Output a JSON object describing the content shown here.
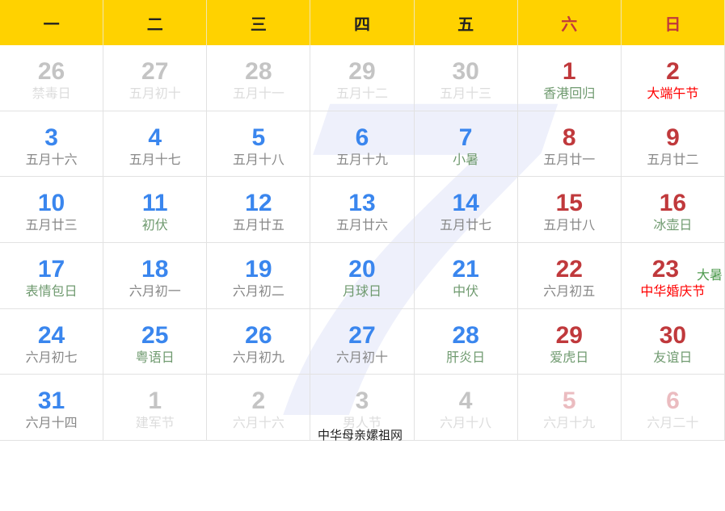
{
  "watermark": "7",
  "weekdays": [
    {
      "label": "一",
      "weekend": false
    },
    {
      "label": "二",
      "weekend": false
    },
    {
      "label": "三",
      "weekend": false
    },
    {
      "label": "四",
      "weekend": false
    },
    {
      "label": "五",
      "weekend": false
    },
    {
      "label": "六",
      "weekend": true
    },
    {
      "label": "日",
      "weekend": true
    }
  ],
  "days": [
    {
      "num": "26",
      "sub": "禁毒日",
      "month": "other"
    },
    {
      "num": "27",
      "sub": "五月初十",
      "month": "other"
    },
    {
      "num": "28",
      "sub": "五月十一",
      "month": "other"
    },
    {
      "num": "29",
      "sub": "五月十二",
      "month": "other"
    },
    {
      "num": "30",
      "sub": "五月十三",
      "month": "other"
    },
    {
      "num": "1",
      "sub": "香港回归",
      "month": "cur",
      "style": "green"
    },
    {
      "num": "2",
      "sub": "大端午节",
      "month": "cur",
      "style": "red"
    },
    {
      "num": "3",
      "sub": "五月十六",
      "month": "cur"
    },
    {
      "num": "4",
      "sub": "五月十七",
      "month": "cur"
    },
    {
      "num": "5",
      "sub": "五月十八",
      "month": "cur"
    },
    {
      "num": "6",
      "sub": "五月十九",
      "month": "cur"
    },
    {
      "num": "7",
      "sub": "小暑",
      "month": "cur",
      "style": "green"
    },
    {
      "num": "8",
      "sub": "五月廿一",
      "month": "cur"
    },
    {
      "num": "9",
      "sub": "五月廿二",
      "month": "cur"
    },
    {
      "num": "10",
      "sub": "五月廿三",
      "month": "cur"
    },
    {
      "num": "11",
      "sub": "初伏",
      "month": "cur",
      "style": "green"
    },
    {
      "num": "12",
      "sub": "五月廿五",
      "month": "cur"
    },
    {
      "num": "13",
      "sub": "五月廿六",
      "month": "cur"
    },
    {
      "num": "14",
      "sub": "五月廿七",
      "month": "cur"
    },
    {
      "num": "15",
      "sub": "五月廿八",
      "month": "cur"
    },
    {
      "num": "16",
      "sub": "冰壶日",
      "month": "cur",
      "style": "green"
    },
    {
      "num": "17",
      "sub": "表情包日",
      "month": "cur",
      "style": "green"
    },
    {
      "num": "18",
      "sub": "六月初一",
      "month": "cur"
    },
    {
      "num": "19",
      "sub": "六月初二",
      "month": "cur"
    },
    {
      "num": "20",
      "sub": "月球日",
      "month": "cur",
      "style": "green"
    },
    {
      "num": "21",
      "sub": "中伏",
      "month": "cur",
      "style": "green"
    },
    {
      "num": "22",
      "sub": "六月初五",
      "month": "cur"
    },
    {
      "num": "23",
      "sub": "中华婚庆节",
      "month": "cur",
      "style": "red",
      "term": "大暑"
    },
    {
      "num": "24",
      "sub": "六月初七",
      "month": "cur"
    },
    {
      "num": "25",
      "sub": "粤语日",
      "month": "cur",
      "style": "green"
    },
    {
      "num": "26",
      "sub": "六月初九",
      "month": "cur"
    },
    {
      "num": "27",
      "sub": "六月初十",
      "month": "cur"
    },
    {
      "num": "28",
      "sub": "肝炎日",
      "month": "cur",
      "style": "green"
    },
    {
      "num": "29",
      "sub": "爱虎日",
      "month": "cur",
      "style": "green"
    },
    {
      "num": "30",
      "sub": "友谊日",
      "month": "cur",
      "style": "green"
    },
    {
      "num": "31",
      "sub": "六月十四",
      "month": "cur"
    },
    {
      "num": "1",
      "sub": "建军节",
      "month": "other"
    },
    {
      "num": "2",
      "sub": "六月十六",
      "month": "other"
    },
    {
      "num": "3",
      "sub": "男人节",
      "month": "other"
    },
    {
      "num": "4",
      "sub": "六月十八",
      "month": "other"
    },
    {
      "num": "5",
      "sub": "六月十九",
      "month": "other"
    },
    {
      "num": "6",
      "sub": "六月二十",
      "month": "other"
    }
  ],
  "footer": "中华母亲嫘祖网",
  "colors": {
    "header_bg": "#ffd200",
    "current_day": "#3a86ee",
    "weekend": "#c0393c",
    "festival_red": "#ff0000",
    "festival_green": "#6f9a6f"
  }
}
